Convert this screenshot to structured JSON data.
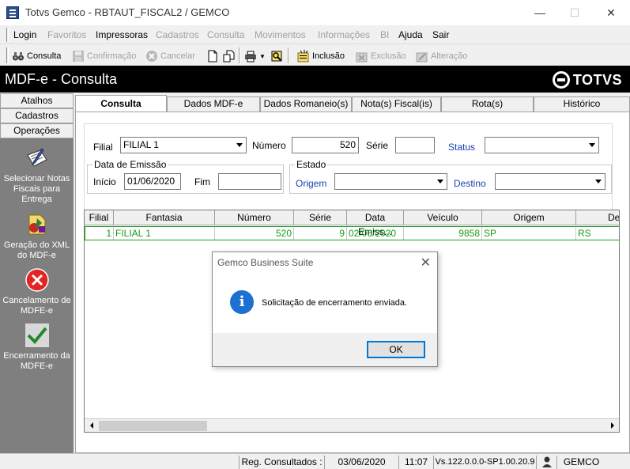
{
  "window": {
    "title": "Totvs Gemco - RBTAUT_FISCAL2 / GEMCO",
    "minimize": "—",
    "maximize": "☐",
    "close": "✕"
  },
  "menu": {
    "items": [
      {
        "label": "Login",
        "enabled": true
      },
      {
        "label": "Favoritos",
        "enabled": false
      },
      {
        "label": "Impressoras",
        "enabled": true
      },
      {
        "label": "Cadastros",
        "enabled": false
      },
      {
        "label": "Consulta",
        "enabled": false
      },
      {
        "label": "Movimentos",
        "enabled": false
      },
      {
        "label": "Informações",
        "enabled": false
      },
      {
        "label": "BI",
        "enabled": false
      },
      {
        "label": "Ajuda",
        "enabled": true
      },
      {
        "label": "Sair",
        "enabled": true
      }
    ]
  },
  "toolbar": {
    "consulta": "Consulta",
    "confirmacao": "Confirmação",
    "cancelar": "Cancelar",
    "inclusao": "Inclusão",
    "exclusao": "Exclusão",
    "alteracao": "Alteração"
  },
  "header": {
    "title": "MDF-e - Consulta",
    "logo": "TOTVS"
  },
  "sidebar": {
    "tabs": [
      "Atalhos",
      "Cadastros",
      "Operações"
    ],
    "operations": [
      {
        "label": "Selecionar Notas Fiscais para Entrega",
        "icon": "pen-paper-icon"
      },
      {
        "label": "Geração do XML do MDF-e",
        "icon": "xml-generate-icon"
      },
      {
        "label": "Cancelamento de MDFE-e",
        "icon": "cancel-x-icon"
      },
      {
        "label": "Encerramento da MDFE-e",
        "icon": "checkmark-icon"
      }
    ]
  },
  "tabs": [
    "Consulta",
    "Dados MDF-e",
    "Dados Romaneio(s)",
    "Nota(s) Fiscal(is)",
    "Rota(s)",
    "Histórico"
  ],
  "filters": {
    "filial_label": "Filial",
    "filial_value": "FILIAL 1",
    "numero_label": "Número",
    "numero_value": "520",
    "serie_label": "Série",
    "serie_value": "",
    "status_label": "Status",
    "status_value": "",
    "data_emissao_group": "Data de Emissão",
    "inicio_label": "Início",
    "inicio_value": "01/06/2020",
    "fim_label": "Fim",
    "fim_value": "",
    "estado_group": "Estado",
    "origem_label": "Origem",
    "origem_value": "",
    "destino_label": "Destino",
    "destino_value": ""
  },
  "grid": {
    "columns": [
      "Filial",
      "Fantasia",
      "Número",
      "Série",
      "Data Emiss...",
      "Veículo",
      "Origem",
      "De"
    ],
    "rows": [
      {
        "filial": "1",
        "fantasia": "FILIAL 1",
        "numero": "520",
        "serie": "9",
        "data": "02/06/2020",
        "veiculo": "9858",
        "origem": "SP",
        "destino": "RS"
      }
    ],
    "row_color": "#1a9b1a"
  },
  "dialog": {
    "title": "Gemco Business Suite",
    "message": "Solicitação de encerramento enviada.",
    "ok": "OK",
    "icon": "info-icon"
  },
  "status": {
    "registros": "Reg. Consultados : 1",
    "date": "03/06/2020",
    "time": "11:07",
    "version": "Vs.122.0.0.0-SP1.00.20.9",
    "user": "GEMCO"
  }
}
